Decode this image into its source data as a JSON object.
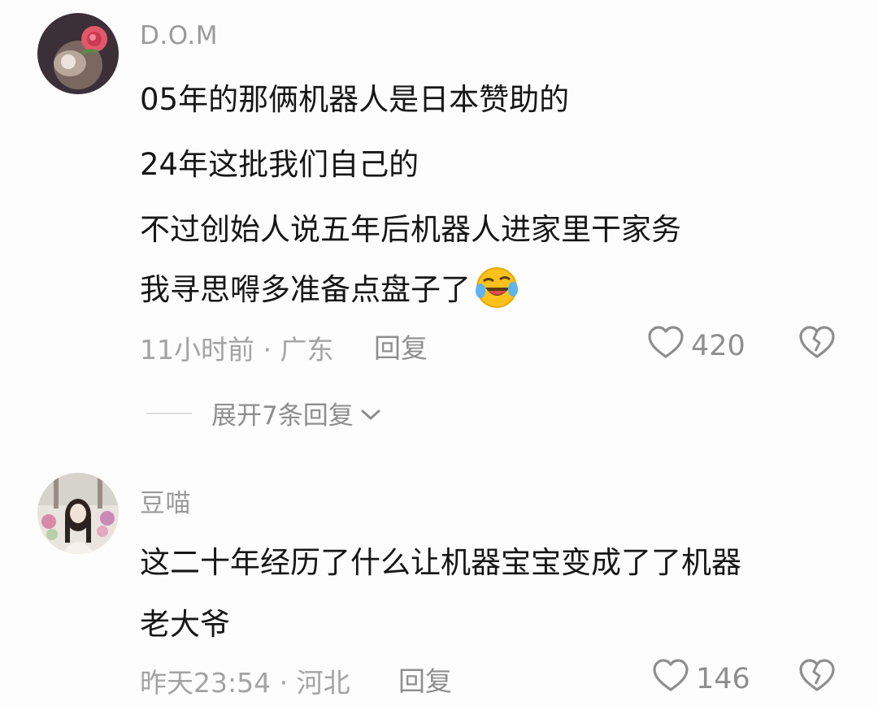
{
  "comments": [
    {
      "username": "D.O.M",
      "lines": [
        "05年的那俩机器人是日本赞助的",
        "24年这批我们自己的",
        "不过创始人说五年后机器人进家里干家务",
        "我寻思嘚多准备点盘子了"
      ],
      "emoji": "laughing-crying-emoji",
      "meta": "11小时前 · 广东",
      "reply_label": "回复",
      "likes": "420",
      "expand_label": "展开7条回复"
    },
    {
      "username": "豆喵",
      "lines": [
        "这二十年经历了什么让机器宝宝变成了了机器",
        "老大爷"
      ],
      "meta": "昨天23:54 · 河北",
      "reply_label": "回复",
      "likes": "146"
    }
  ],
  "icons": {
    "like": "heart-outline-icon",
    "dislike": "broken-heart-icon",
    "expand": "chevron-down-icon"
  },
  "colors": {
    "background": "#fdfdfd",
    "text": "#161616",
    "secondary": "#9a9a9a"
  }
}
